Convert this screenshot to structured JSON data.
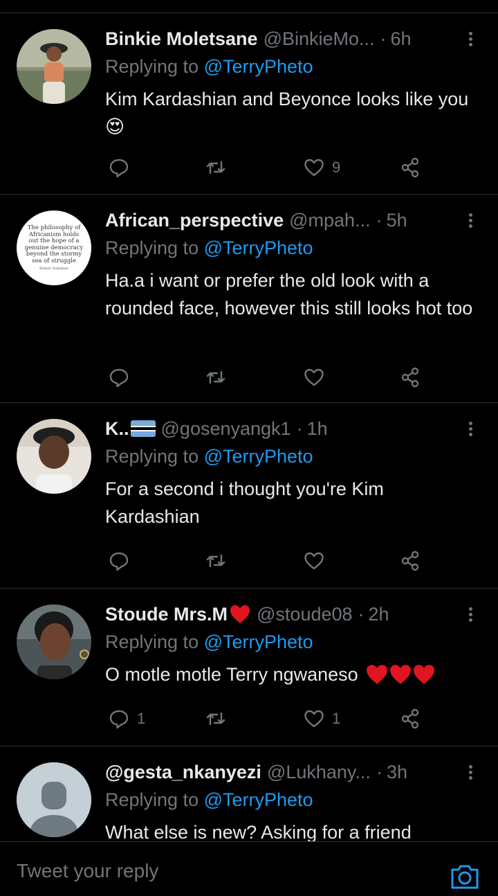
{
  "colors": {
    "background": "#000000",
    "text": "#e7e9ea",
    "secondary": "#71767b",
    "accent": "#1d9bf0",
    "divider": "#2f3336"
  },
  "tweets": [
    {
      "name": "Binkie Moletsane",
      "handle": "@BinkieMo...",
      "dot": "·",
      "time": "6h",
      "replying_prefix": "Replying to",
      "replying_to": "@TerryPheto",
      "text": "Kim Kardashian and Beyonce looks like you",
      "text_emoji": "😍",
      "reply_count": "",
      "retweet_count": "",
      "like_count": "9"
    },
    {
      "name": "African_perspective",
      "handle": "@mpah...",
      "dot": "·",
      "time": "5h",
      "replying_prefix": "Replying to",
      "replying_to": "@TerryPheto",
      "text": "Ha.a i want or prefer the old look with a rounded face, however this still looks hot too",
      "avatar_quote": "The philosophy of Africanism holds out the hope of a genuine democracy beyond the stormy sea of struggle",
      "avatar_quote_author": "Robert Sobukwe",
      "reply_count": "",
      "retweet_count": "",
      "like_count": ""
    },
    {
      "name": "K..",
      "name_flag": "flag-icon",
      "handle": "@gosenyangk1",
      "dot": "·",
      "time": "1h",
      "replying_prefix": "Replying to",
      "replying_to": "@TerryPheto",
      "text": "For a second i thought you're Kim Kardashian",
      "reply_count": "",
      "retweet_count": "",
      "like_count": ""
    },
    {
      "name": "Stoude Mrs.M",
      "name_emoji": "red-heart-icon",
      "handle": "@stoude08",
      "dot": "·",
      "time": "2h",
      "replying_prefix": "Replying to",
      "replying_to": "@TerryPheto",
      "text": "O motle motle Terry ngwaneso",
      "text_emoji": "red-heart-icon x3",
      "reply_count": "1",
      "retweet_count": "",
      "like_count": "1"
    },
    {
      "name": "@gesta_nkanyezi",
      "handle": "@Lukhany...",
      "dot": "·",
      "time": "3h",
      "replying_prefix": "Replying to",
      "replying_to": "@TerryPheto",
      "text": "What else is new? Asking for a friend"
    }
  ],
  "composer": {
    "placeholder": "Tweet your reply",
    "camera_icon": "camera-icon"
  }
}
